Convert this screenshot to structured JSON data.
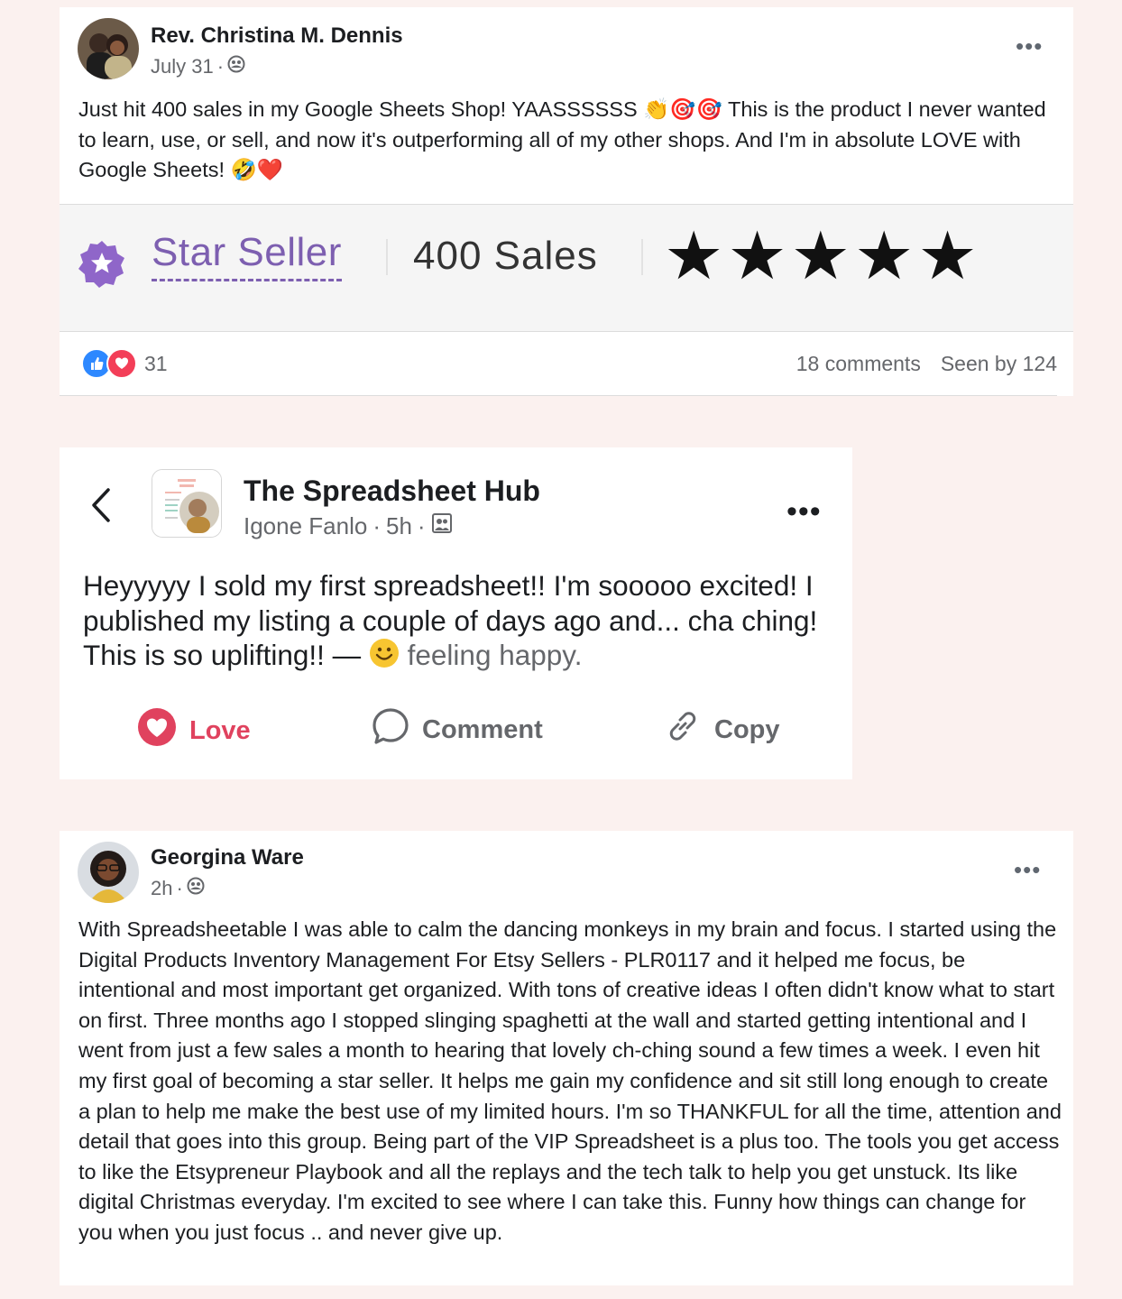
{
  "post1": {
    "author": "Rev. Christina M. Dennis",
    "date": "July 31",
    "text": "Just hit 400 sales in my Google Sheets Shop! YAASSSSSS 👏🎯🎯 This is the product I never wanted to learn, use, or sell, and now it's outperforming all of my other shops. And I'm in absolute LOVE with Google Sheets! 🤣❤️",
    "badge": {
      "label": "Star Seller",
      "sales": "400 Sales",
      "rating": 5,
      "stars_text": "★★★★★"
    },
    "reactions_count": "31",
    "comments": "18 comments",
    "seen_by": "Seen by 124"
  },
  "post2": {
    "group_name": "The Spreadsheet Hub",
    "author": "Igone Fanlo",
    "time": "5h",
    "text": "Heyyyyy I sold my first spreadsheet!! I'm sooooo excited! I published my listing a couple of days ago and... cha ching! This is so uplifting!! —",
    "feeling": "feeling happy.",
    "actions": {
      "love": "Love",
      "comment": "Comment",
      "copy": "Copy"
    }
  },
  "post3": {
    "author": "Georgina Ware",
    "time": "2h",
    "text": "With Spreadsheetable I was able to calm the dancing monkeys in my brain and focus. I started using the Digital Products Inventory Management For Etsy Sellers - PLR0117 and it helped me focus, be intentional and most important get organized. With tons of creative ideas I often didn't know what to start on first. Three months ago I stopped slinging spaghetti at the wall and started getting intentional and I went from just a few sales a month to hearing that lovely ch-ching sound a few times a week. I even hit my first goal of becoming a star seller. It helps me gain my confidence and sit still long enough to create a plan to help me make the best use of my limited hours. I'm so THANKFUL for all the time, attention and detail that goes into this group. Being part of the VIP Spreadsheet is a plus too. The tools you get access to like the Etsypreneur Playbook and all the replays and the tech talk to help you get unstuck. Its like digital Christmas everyday. I'm excited to see where I can take this. Funny how things can change for you when you just focus .. and never give up."
  },
  "colors": {
    "page_bg": "#fbf1ef",
    "star_seller_purple": "#7d5fb0",
    "love_red": "#e0425e",
    "like_blue": "#2d88ff"
  }
}
